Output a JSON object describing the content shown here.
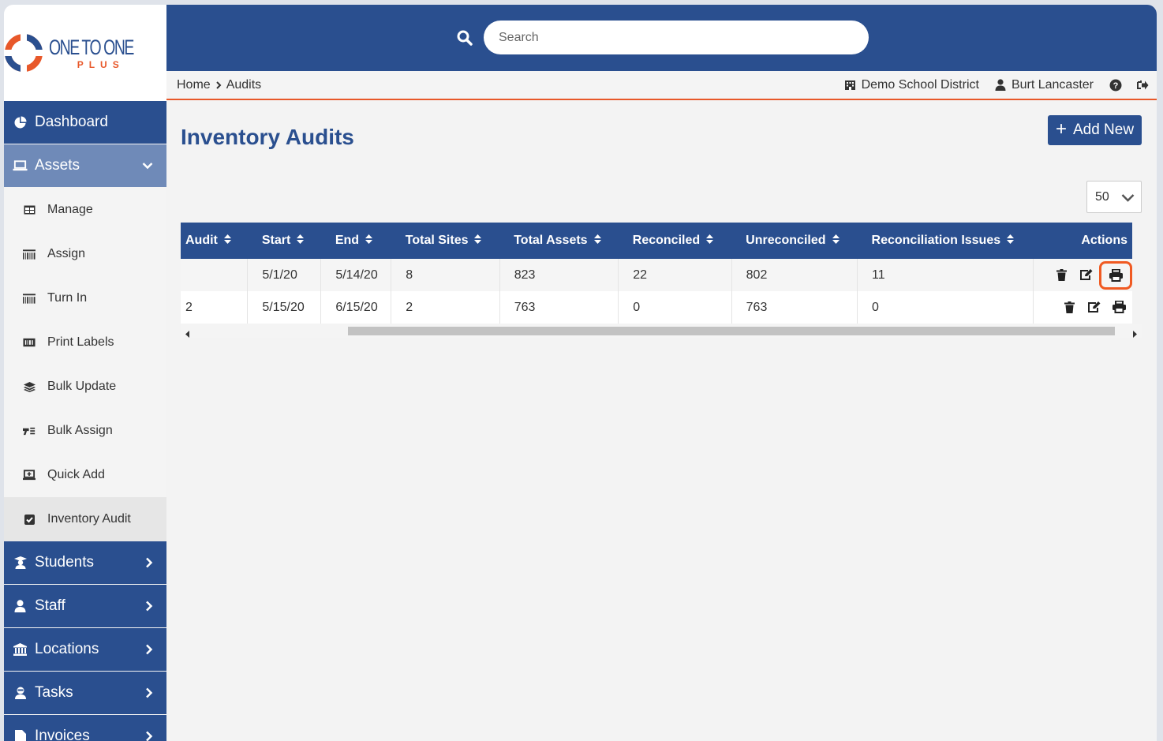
{
  "brand": {
    "logo_main": "ONE TO ONE",
    "logo_sub": "PLUS",
    "primary_color": "#2a4f8f",
    "accent_color": "#e8582a"
  },
  "header": {
    "search_placeholder": "Search"
  },
  "breadcrumb": {
    "home": "Home",
    "current": "Audits"
  },
  "user_bar": {
    "district": "Demo School District",
    "user": "Burt Lancaster"
  },
  "sidebar": {
    "dashboard": "Dashboard",
    "assets": "Assets",
    "assets_sub": [
      {
        "label": "Manage",
        "icon": "table-icon"
      },
      {
        "label": "Assign",
        "icon": "barcode-icon"
      },
      {
        "label": "Turn In",
        "icon": "barcode-icon"
      },
      {
        "label": "Print Labels",
        "icon": "label-icon"
      },
      {
        "label": "Bulk Update",
        "icon": "layers-icon"
      },
      {
        "label": "Bulk Assign",
        "icon": "bulk-assign-icon"
      },
      {
        "label": "Quick Add",
        "icon": "laptop-plus-icon"
      },
      {
        "label": "Inventory Audit",
        "icon": "checkbox-icon"
      }
    ],
    "students": "Students",
    "staff": "Staff",
    "locations": "Locations",
    "tasks": "Tasks",
    "invoices": "Invoices"
  },
  "main": {
    "title": "Inventory Audits",
    "add_button": "Add New",
    "page_size": "50"
  },
  "table": {
    "columns": [
      "Audit",
      "Start",
      "End",
      "Total Sites",
      "Total Assets",
      "Reconciled",
      "Unreconciled",
      "Reconciliation Issues",
      "Actions"
    ],
    "rows": [
      {
        "audit": "",
        "start": "5/1/20",
        "end": "5/14/20",
        "total_sites": "8",
        "total_assets": "823",
        "reconciled": "22",
        "unreconciled": "802",
        "issues": "11"
      },
      {
        "audit": "2",
        "start": "5/15/20",
        "end": "6/15/20",
        "total_sites": "2",
        "total_assets": "763",
        "reconciled": "0",
        "unreconciled": "763",
        "issues": "0"
      }
    ]
  }
}
